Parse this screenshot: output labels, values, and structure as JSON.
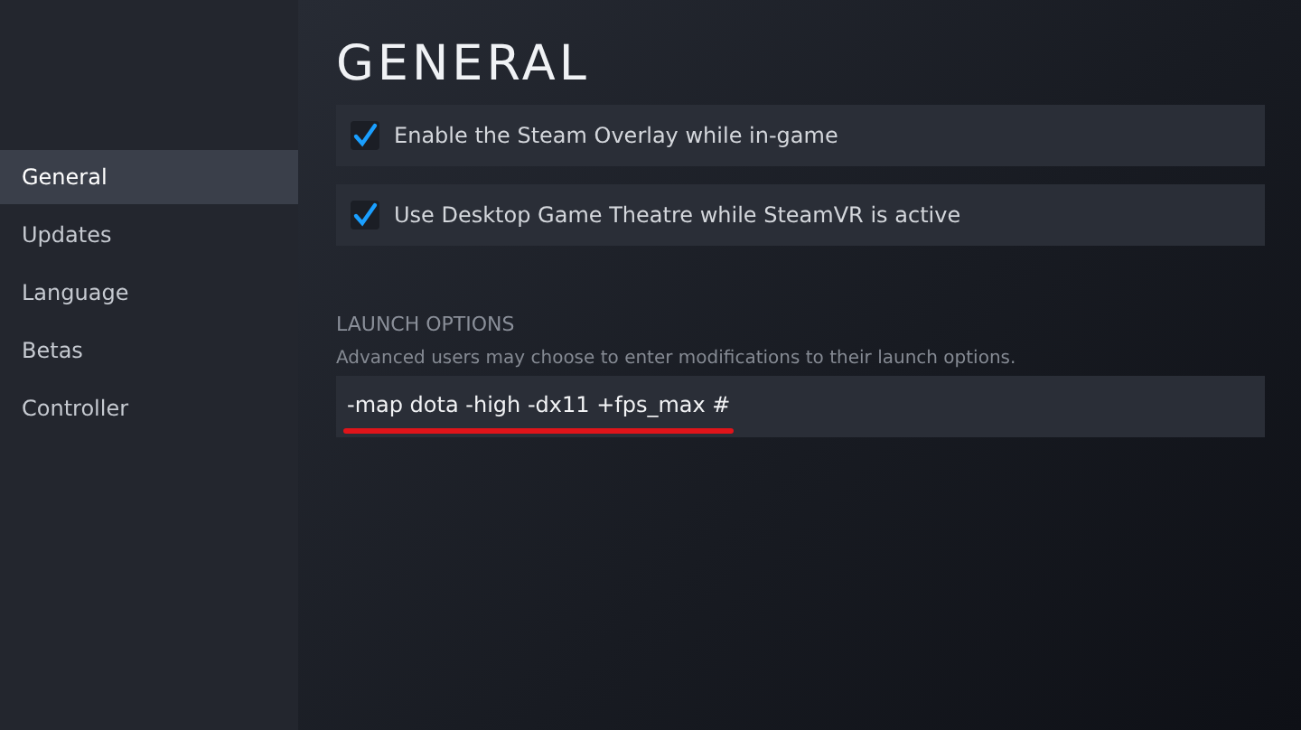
{
  "sidebar": {
    "items": [
      {
        "label": "General",
        "selected": true
      },
      {
        "label": "Updates",
        "selected": false
      },
      {
        "label": "Language",
        "selected": false
      },
      {
        "label": "Betas",
        "selected": false
      },
      {
        "label": "Controller",
        "selected": false
      }
    ]
  },
  "page": {
    "title": "GENERAL",
    "options": [
      {
        "label": "Enable the Steam Overlay while in-game",
        "checked": true
      },
      {
        "label": "Use Desktop Game Theatre while SteamVR is active",
        "checked": true
      }
    ],
    "launch_options": {
      "heading": "LAUNCH OPTIONS",
      "description": "Advanced users may choose to enter modifications to their launch options.",
      "value": "-map dota -high -dx11 +fps_max #",
      "underlined": true
    }
  }
}
